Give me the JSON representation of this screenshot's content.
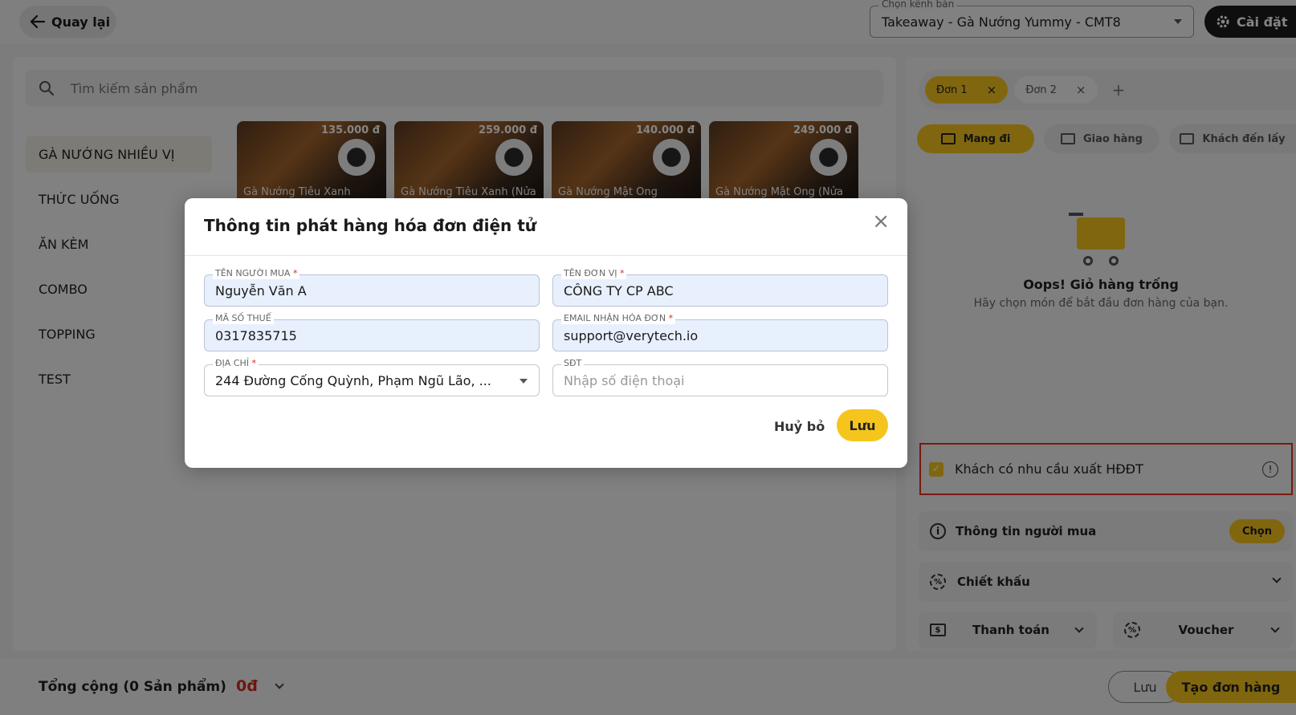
{
  "header": {
    "back_label": "Quay lại",
    "channel_label": "Chọn kênh bán",
    "channel_value": "Takeaway - Gà Nướng Yummy - CMT8",
    "settings_label": "Cài đặt"
  },
  "search": {
    "placeholder": "Tìm kiếm sản phẩm"
  },
  "categories": [
    {
      "label": "GÀ NƯỚNG NHIỀU VỊ"
    },
    {
      "label": "THỨC UỐNG"
    },
    {
      "label": "ĂN KÈM"
    },
    {
      "label": "COMBO"
    },
    {
      "label": "TOPPING"
    },
    {
      "label": "TEST"
    }
  ],
  "products": [
    {
      "price": "135.000 đ",
      "name": "Gà Nướng Tiêu Xanh"
    },
    {
      "price": "259.000 đ",
      "name": "Gà Nướng Tiêu Xanh (Nửa"
    },
    {
      "price": "140.000 đ",
      "name": "Gà Nướng Mật Ong"
    },
    {
      "price": "249.000 đ",
      "name": "Gà Nướng Mật Ong (Nửa"
    }
  ],
  "order_tabs": [
    {
      "label": "Đơn 1"
    },
    {
      "label": "Đơn 2"
    }
  ],
  "order_tabs_close": "×",
  "order_tabs_add": "+",
  "shipping": [
    {
      "label": "Mang đi"
    },
    {
      "label": "Giao hàng"
    },
    {
      "label": "Khách đến lấy"
    }
  ],
  "empty_cart": {
    "title": "Oops! Giỏ hàng trống",
    "subtitle": "Hãy chọn món để bắt đầu đơn hàng của bạn."
  },
  "invoice_checkbox": {
    "label": "Khách có nhu cầu xuất HĐĐT",
    "checked": true
  },
  "buyer_info": {
    "label": "Thông tin người mua",
    "button": "Chọn"
  },
  "discount": {
    "label": "Chiết khấu"
  },
  "payment": {
    "label": "Thanh toán"
  },
  "voucher": {
    "label": "Voucher"
  },
  "footer": {
    "total_label": "Tổng cộng (0 Sản phẩm)",
    "total_value": "0đ",
    "save_label": "Lưu",
    "create_label": "Tạo đơn hàng"
  },
  "modal": {
    "title": "Thông tin phát hàng hóa đơn điện tử",
    "close": "×",
    "fields": {
      "buyer_name": {
        "label": "TÊN NGƯỜI MUA",
        "required": "*",
        "value": "Nguyễn Văn A"
      },
      "company": {
        "label": "TÊN ĐƠN VỊ",
        "required": "*",
        "value": "CÔNG TY CP ABC"
      },
      "tax_code": {
        "label": "MÃ SỐ THUẾ",
        "value": "0317835715"
      },
      "email": {
        "label": "EMAIL NHẬN HÓA ĐƠN",
        "required": "*",
        "value": "support@verytech.io"
      },
      "address": {
        "label": "ĐỊA CHỈ",
        "required": "*",
        "value": "244 Đường Cống Quỳnh, Phạm Ngũ Lão, ..."
      },
      "phone": {
        "label": "SĐT",
        "placeholder": "Nhập số điện thoại"
      }
    },
    "cancel_label": "Huỷ bỏ",
    "save_label": "Lưu"
  },
  "colors": {
    "accent": "#f5c51d",
    "danger": "#d02b20",
    "highlight_border": "#e8321e"
  },
  "icons": {
    "back": "arrow-left-icon",
    "settings": "gear-icon",
    "search": "search-icon",
    "info": "info-icon",
    "discount": "discount-badge-icon",
    "payment": "cash-icon",
    "voucher": "voucher-icon"
  }
}
